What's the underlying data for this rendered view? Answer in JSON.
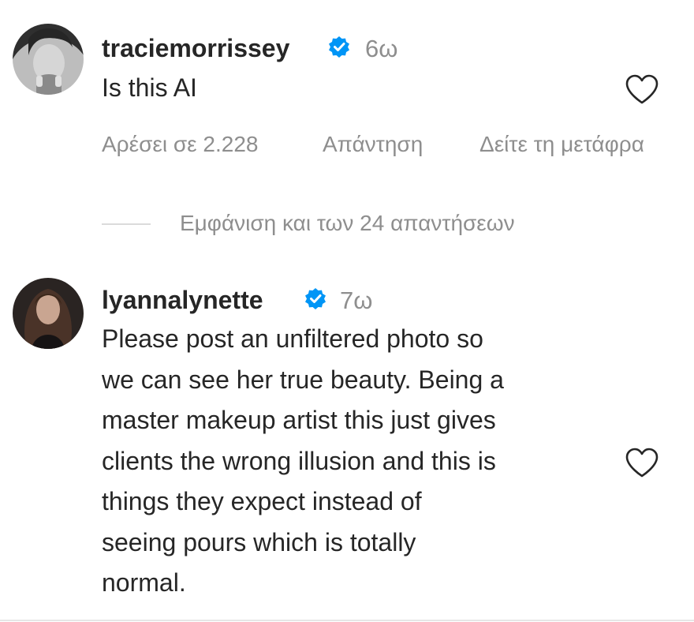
{
  "comments": [
    {
      "username": "traciemorrissey",
      "verified": true,
      "time": "6ω",
      "text": "Is this AI",
      "likes": "Αρέσει σε 2.228",
      "reply": "Απάντηση",
      "translate": "Δείτε τη μετάφρα",
      "view_replies": "Εμφάνιση και των 24 απαντήσεων",
      "like_icon": "heart-outline-icon"
    },
    {
      "username": "lyannalynette",
      "verified": true,
      "time": "7ω",
      "text": "Please post an unfiltered photo so\nwe can see her true beauty. Being a\nmaster makeup artist this just gives\nclients the wrong illusion and this is\nthings they expect instead of\nseeing pours which is totally\nnormal.",
      "like_icon": "heart-outline-icon"
    }
  ],
  "colors": {
    "text": "#262626",
    "secondary": "#8e8e8e",
    "verified_blue": "#0095f6",
    "divider": "#dbdbdb"
  }
}
